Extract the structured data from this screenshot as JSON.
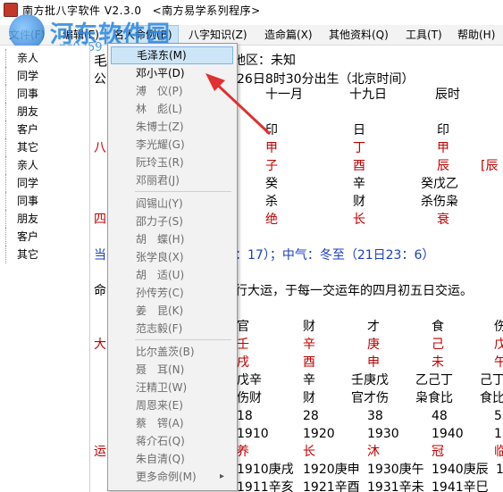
{
  "window": {
    "title": "南方批八字软件 V2.3.0",
    "subtitle": "<南方易学系列程序>"
  },
  "watermark": {
    "text": "河东软件园",
    "url": "pc0359"
  },
  "menubar": {
    "file": "文件(F)",
    "edit": "编辑(E)",
    "cases": "名人命例(B)",
    "knowledge": "八字知识(Z)",
    "fate": "造命篇(X)",
    "other": "其他资料(Q)",
    "tools": "工具(T)",
    "help": "帮助(H)"
  },
  "sidebar": {
    "items": [
      "亲人",
      "同学",
      "同事",
      "朋友",
      "客户",
      "其它",
      "亲人",
      "同学",
      "同事",
      "朋友",
      "客户",
      "其它"
    ]
  },
  "dropdown": {
    "items": [
      {
        "label": "毛泽东(M)",
        "state": "highlight"
      },
      {
        "label": "邓小平(D)",
        "state": "enabled"
      },
      {
        "label": "溥　仪(P)",
        "state": "disabled"
      },
      {
        "label": "林　彪(L)",
        "state": "disabled"
      },
      {
        "label": "朱博士(Z)",
        "state": "disabled"
      },
      {
        "label": "李光耀(G)",
        "state": "disabled"
      },
      {
        "label": "阮玲玉(R)",
        "state": "disabled"
      },
      {
        "label": "邓丽君(J)",
        "state": "disabled"
      },
      {
        "label": "阎锡山(Y)",
        "state": "disabled"
      },
      {
        "label": "邵力子(S)",
        "state": "disabled"
      },
      {
        "label": "胡　蝶(H)",
        "state": "disabled"
      },
      {
        "label": "张学良(X)",
        "state": "disabled"
      },
      {
        "label": "胡　适(U)",
        "state": "disabled"
      },
      {
        "label": "孙传芳(C)",
        "state": "disabled"
      },
      {
        "label": "姜　昆(K)",
        "state": "disabled"
      },
      {
        "label": "范志毅(F)",
        "state": "disabled"
      },
      {
        "label": "比尔盖茨(B)",
        "state": "disabled"
      },
      {
        "label": "聂　耳(N)",
        "state": "disabled"
      },
      {
        "label": "汪精卫(W)",
        "state": "disabled"
      },
      {
        "label": "周恩来(E)",
        "state": "disabled"
      },
      {
        "label": "蔡　锷(A)",
        "state": "disabled"
      },
      {
        "label": "蒋介石(Q)",
        "state": "disabled"
      },
      {
        "label": "朱自清(Q)",
        "state": "disabled"
      },
      {
        "label": "更多命例(M)",
        "state": "disabled"
      }
    ],
    "submenu_arrow": "▸"
  },
  "chart": {
    "line1_name": "毛",
    "line1_place": "地区：未知",
    "line2_prefix": "公",
    "line2_text": "26日8时30分出生（北京时间）",
    "month": "十一月",
    "day": "十九日",
    "hour": "辰时",
    "label_ba": "八",
    "label_si": "四",
    "ten_gods": [
      "印",
      "日",
      "印"
    ],
    "stems": [
      "甲",
      "丁",
      "甲"
    ],
    "branches": [
      "子",
      "酉",
      "辰"
    ],
    "branch_extra": "[辰",
    "hidden": [
      "癸",
      "辛",
      "癸戊乙"
    ],
    "hidden_gods": [
      "杀",
      "财",
      "杀伤枭"
    ],
    "stages": [
      "绝",
      "长",
      "衰"
    ],
    "jieqi_prefix": "当",
    "jieqi": "：17）；中气：冬至（21日23：6）",
    "dayun_prefix": "命",
    "dayun": "行大运，于每一交运年的四月初五日交运。",
    "da_label": "大",
    "yun_label": "运",
    "dy_gods": [
      "官",
      "财",
      "才",
      "食",
      "伤"
    ],
    "dy_stems": [
      "壬",
      "辛",
      "庚",
      "己",
      "戊"
    ],
    "dy_branches": [
      "戌",
      "酉",
      "申",
      "未",
      "午"
    ],
    "dy_hidden": [
      "戊辛",
      "辛",
      "壬庚戊",
      "乙己丁",
      "己丁"
    ],
    "dy_hidden_gods": [
      "伤财",
      "财",
      "官才伤",
      "枭食比",
      "食比"
    ],
    "dy_ages": [
      "18",
      "28",
      "38",
      "48",
      "5"
    ],
    "dy_years": [
      "1910",
      "1920",
      "1930",
      "1940",
      "1"
    ],
    "dy_stages": [
      "养",
      "长",
      "沐",
      "冠",
      "临"
    ],
    "ln_row1": [
      "1910庚戌",
      "1920庚申",
      "1930庚午",
      "1940庚辰",
      "1"
    ],
    "ln_row2": [
      "1911辛亥",
      "1921辛酉",
      "1931辛未",
      "1941辛巳",
      ""
    ]
  }
}
